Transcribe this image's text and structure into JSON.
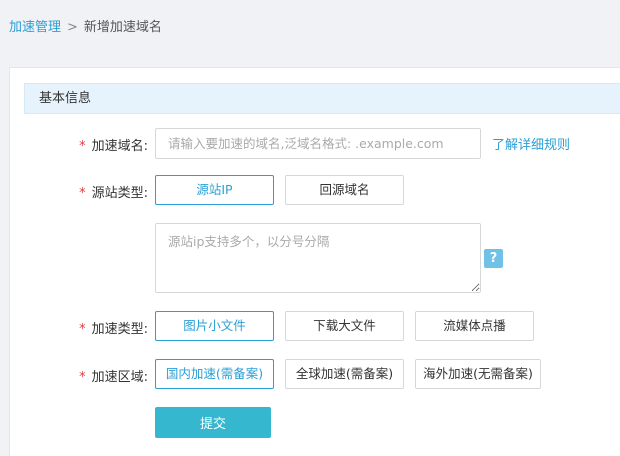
{
  "breadcrumb": {
    "parent": "加速管理",
    "separator": ">",
    "current": "新增加速域名"
  },
  "section": {
    "title": "基本信息"
  },
  "form": {
    "required_mark": "*",
    "domain": {
      "label": "加速域名:",
      "placeholder": "请输入要加速的域名,泛域名格式: .example.com",
      "value": "",
      "link": "了解详细规则"
    },
    "origin_type": {
      "label": "源站类型:",
      "options": [
        "源站IP",
        "回源域名"
      ],
      "selected": "源站IP",
      "ip_placeholder": "源站ip支持多个，以分号分隔",
      "help": "?"
    },
    "accel_type": {
      "label": "加速类型:",
      "options": [
        "图片小文件",
        "下载大文件",
        "流媒体点播"
      ],
      "selected": "图片小文件"
    },
    "accel_region": {
      "label": "加速区域:",
      "options": [
        "国内加速(需备案)",
        "全球加速(需备案)",
        "海外加速(无需备案)"
      ],
      "selected": "国内加速(需备案)"
    },
    "submit_label": "提交"
  },
  "colors": {
    "accent": "#2a9fd6",
    "submit": "#35b8cf",
    "required": "#e4393c",
    "section_bg": "#e6f3fc"
  }
}
